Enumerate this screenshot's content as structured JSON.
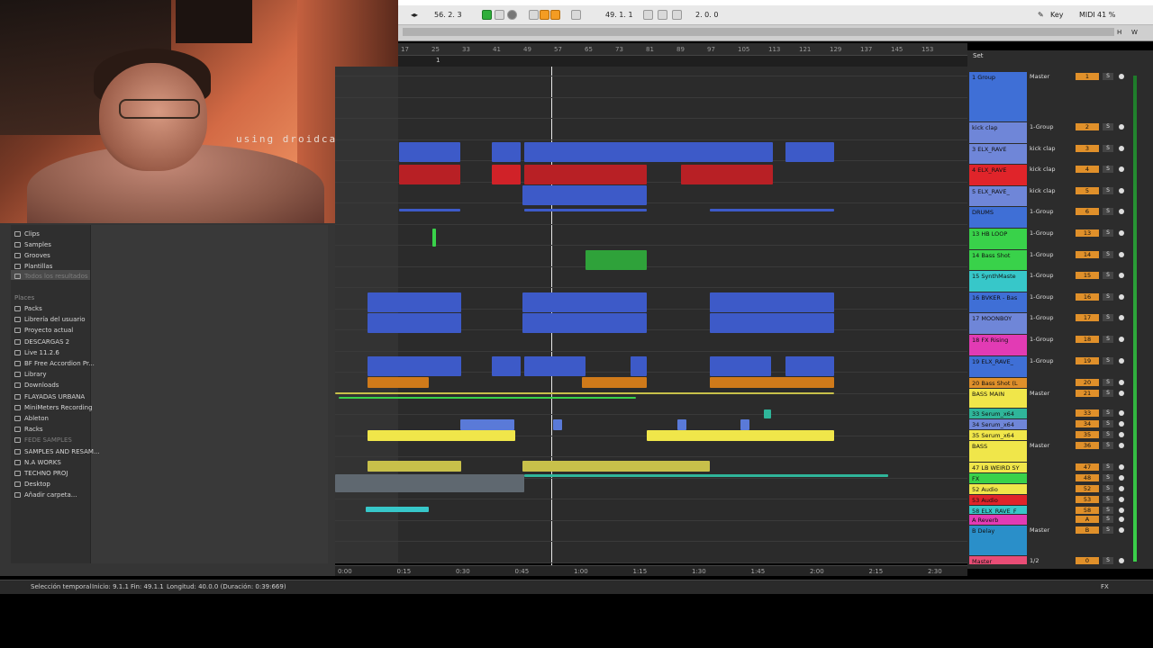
{
  "webcam": {
    "caption": "using droidcam.app"
  },
  "transport": {
    "tempo": "56. 2. 3",
    "position": "49. 1. 1",
    "loop_length": "2. 0. 0",
    "key_label": "Key",
    "midi_label": "MIDI",
    "cpu": "41 %",
    "hw_h": "H",
    "hw_w": "W"
  },
  "ruler": {
    "bars": [
      "17",
      "25",
      "33",
      "41",
      "49",
      "57",
      "65",
      "73",
      "81",
      "89",
      "97",
      "105",
      "113",
      "121",
      "129",
      "137",
      "145",
      "153"
    ],
    "locator": "1"
  },
  "timeline": {
    "times": [
      "0:00",
      "0:15",
      "0:30",
      "0:45",
      "1:00",
      "1:15",
      "1:30",
      "1:45",
      "2:00",
      "2:15",
      "2:30"
    ]
  },
  "browser": {
    "categories": [
      "Clips",
      "Samples",
      "Grooves",
      "Plantillas",
      "Todos los resultados"
    ],
    "places_header": "Places",
    "places": [
      "Packs",
      "Librería del usuario",
      "Proyecto actual",
      "DESCARGAS 2",
      "Live 11.2.6",
      "BF Free Accordion Pr...",
      "Library",
      "Downloads",
      "FLAYADAS URBANA",
      "MiniMeters Recording",
      "Ableton",
      "Racks",
      "FEDE SAMPLES",
      "SAMPLES AND RESAM...",
      "N.A WORKS",
      "TECHNO PROJ",
      "Desktop",
      "Añadir carpeta..."
    ]
  },
  "tracks_header": {
    "set_label": "Set"
  },
  "tracks": [
    {
      "name": "1 Group",
      "io": "Master",
      "num": "1",
      "color": "#3f6fd6"
    },
    {
      "name": "kick clap",
      "io": "1-Group",
      "num": "2",
      "color": "#6f86d8"
    },
    {
      "name": "3 ELX_RAVE",
      "io": "kick clap",
      "num": "3",
      "color": "#6f86d8"
    },
    {
      "name": "4 ELX_RAVE",
      "io": "kick clap",
      "num": "4",
      "color": "#e0242a"
    },
    {
      "name": "5 ELX_RAVE_",
      "io": "kick clap",
      "num": "5",
      "color": "#6f86d8"
    },
    {
      "name": "DRUMS",
      "io": "1-Group",
      "num": "6",
      "color": "#3f6fd6"
    },
    {
      "name": "13 HB LOOP",
      "io": "1-Group",
      "num": "13",
      "color": "#39d24a"
    },
    {
      "name": "14 Bass Shot",
      "io": "1-Group",
      "num": "14",
      "color": "#39d24a"
    },
    {
      "name": "15 SynthMaste",
      "io": "1-Group",
      "num": "15",
      "color": "#37c7c9"
    },
    {
      "name": "16 BVKER - Bas",
      "io": "1-Group",
      "num": "16",
      "color": "#3f6fd6"
    },
    {
      "name": "17 MOONBOY",
      "io": "1-Group",
      "num": "17",
      "color": "#6f86d8"
    },
    {
      "name": "18 FX Rising",
      "io": "1-Group",
      "num": "18",
      "color": "#e23bb4"
    },
    {
      "name": "19 ELX_RAVE_",
      "io": "1-Group",
      "num": "19",
      "color": "#3f6fd6"
    },
    {
      "name": "20 Bass Shot (L",
      "io": "",
      "num": "20",
      "color": "#e0902a"
    },
    {
      "name": "BASS MAIN",
      "io": "Master",
      "num": "21",
      "color": "#f0e64a"
    },
    {
      "name": "33 Serum_x64",
      "io": "",
      "num": "33",
      "color": "#2fb59a"
    },
    {
      "name": "34 Serum_x64",
      "io": "",
      "num": "34",
      "color": "#6f86d8"
    },
    {
      "name": "35 Serum_x64",
      "io": "",
      "num": "35",
      "color": "#f0e64a"
    },
    {
      "name": "BASS",
      "io": "Master",
      "num": "36",
      "color": "#f0e64a"
    },
    {
      "name": "47 LB WEIRD SY",
      "io": "",
      "num": "47",
      "color": "#f0e64a"
    },
    {
      "name": "FX",
      "io": "",
      "num": "48",
      "color": "#39d24a"
    },
    {
      "name": "52 Audio",
      "io": "",
      "num": "52",
      "color": "#f0e64a"
    },
    {
      "name": "53 Audio",
      "io": "",
      "num": "53",
      "color": "#e0242a"
    },
    {
      "name": "58 ELX_RAVE_F",
      "io": "",
      "num": "58",
      "color": "#37c7c9"
    },
    {
      "name": "A Reverb",
      "io": "",
      "num": "A",
      "color": "#e23bb4"
    },
    {
      "name": "B Delay",
      "io": "Master",
      "num": "B",
      "color": "#2a8fc9"
    },
    {
      "name": "Master",
      "io": "1/2",
      "num": "0",
      "color": "#e94d76"
    }
  ],
  "status": {
    "mode": "Selección temporal",
    "start": "Inicio: 9.1.1",
    "end": "Fin: 49.1.1",
    "length": "Longitud: 40.0.0 (Duración: 0:39:669)",
    "fx": "FX"
  }
}
